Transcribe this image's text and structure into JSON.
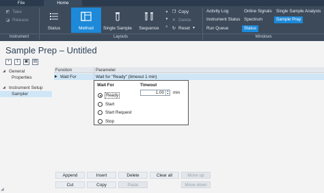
{
  "tabs": {
    "file": "File",
    "home": "Home"
  },
  "ribbon": {
    "instrument": {
      "take": "Take",
      "release": "Release",
      "label": "Instrument"
    },
    "layouts": {
      "status": "Status",
      "method": "Method",
      "single_sample": "Single Sample",
      "sequence": "Sequence",
      "copy": "Copy",
      "delete": "Delete",
      "reset": "Reset",
      "label": "Layouts"
    },
    "windows": {
      "activity_log": "Activity Log",
      "online_signals": "Online Signals",
      "single_sample_analysis": "Single Sample Analysis",
      "instrument_status": "Instrument Status",
      "spectrum": "Spectrum",
      "sample_prep": "Sample Prep",
      "run_queue": "Run Queue",
      "status": "Status",
      "label": "Windows"
    }
  },
  "page": {
    "title": "Sample Prep – Untitled"
  },
  "nav": {
    "general": "General",
    "properties": "Properties",
    "instrument_setup": "Instrument Setup",
    "sampler": "Sampler"
  },
  "grid": {
    "col_function": "Function",
    "col_parameter": "Parameter",
    "row": {
      "function": "Wait For",
      "parameter": "Wait for \"Ready\" (timeout 1 min)"
    }
  },
  "popup": {
    "wait_for_label": "Wait For",
    "timeout_label": "Timeout",
    "options": [
      "Ready",
      "Start",
      "Start Request",
      "Stop"
    ],
    "selected": "Ready",
    "timeout_value": "1.00",
    "timeout_unit": "min"
  },
  "buttons": {
    "append": "Append",
    "insert": "Insert",
    "delete": "Delete",
    "clear_all": "Clear all",
    "move_up": "Move up",
    "cut": "Cut",
    "copy": "Copy",
    "paste": "Paste",
    "move_down": "Move down"
  },
  "colors": {
    "ribbon_bg": "#3c4a5a",
    "accent": "#1d89d8",
    "selection": "#cfe6f7",
    "title": "#2c3e57"
  }
}
